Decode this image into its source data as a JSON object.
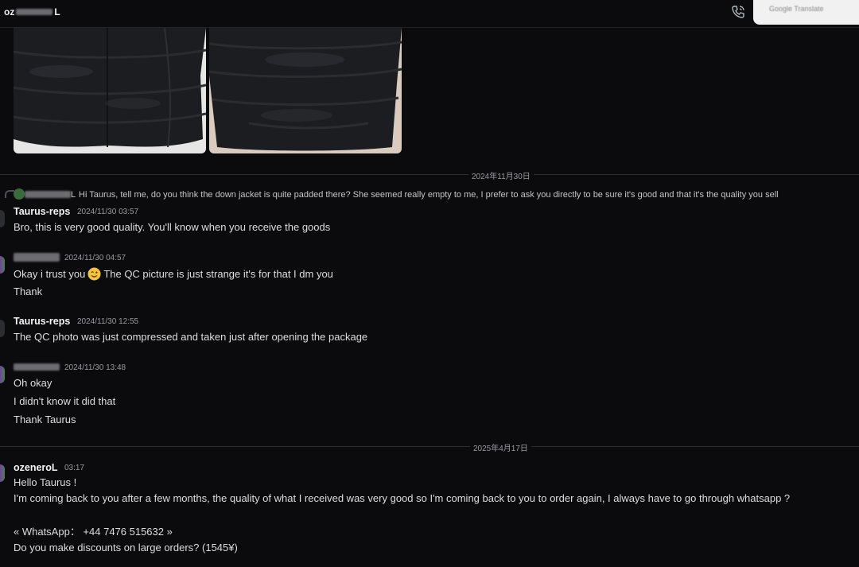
{
  "header": {
    "channel_prefix": "oz",
    "channel_suffix": "L",
    "translate_label": "Google Translate"
  },
  "dividers": [
    {
      "label": "2024年11月30日"
    },
    {
      "label": "2025年4月17日"
    }
  ],
  "reply": {
    "author_suffix": "L",
    "text": "Hi Taurus, tell me, do you think the down jacket is quite padded there? She seemed really empty to me, I prefer to ask you directly to be sure it's good and that it's the quality you sell"
  },
  "messages": [
    {
      "author": "Taurus-reps",
      "time": "2024/11/30 03:57",
      "lines": [
        "Bro, this is very good quality. You'll know when you receive the goods"
      ]
    },
    {
      "author": "",
      "time": "2024/11/30 04:57",
      "line1_before": "Okay i trust you",
      "line1_after": "The QC picture is just strange it's for that I dm you",
      "line2": "Thank"
    },
    {
      "author": "Taurus-reps",
      "time": "2024/11/30 12:55",
      "lines": [
        "The QC photo was just compressed and taken just after opening the package"
      ]
    },
    {
      "author": "",
      "time": "2024/11/30 13:48",
      "lines": [
        "Oh okay",
        "I didn't know it did that",
        "Thank Taurus"
      ]
    },
    {
      "author": "ozeneroL",
      "time": "03:17",
      "lines": [
        "Hello Taurus !",
        "I'm coming back to you after a few months, the quality of what I received was very good so I'm coming back to you to order again, I always have to go through whatsapp ?",
        "« WhatsApp： +44 7476 515632 »",
        "Do you make discounts on large orders? (1545¥)"
      ]
    }
  ],
  "colors": {
    "background": "#0b0b0d",
    "text": "#dcddde",
    "muted": "#9a9ba2"
  }
}
